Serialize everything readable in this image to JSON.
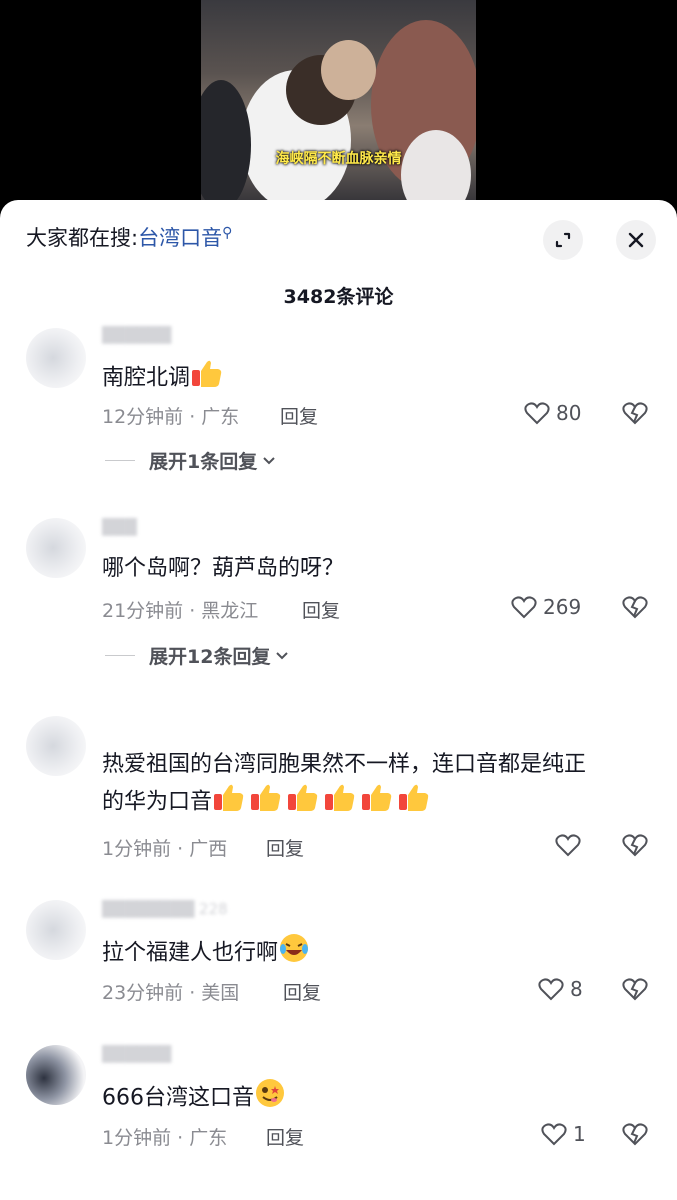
{
  "video": {
    "subtitle": "海峡隔不断血脉亲情"
  },
  "search": {
    "prefix": "大家都在搜:",
    "term": "台湾口音"
  },
  "comment_count": "3482条评论",
  "comments": [
    {
      "text": "南腔北调",
      "emoji": "thumbs-up",
      "time": "12分钟前 · 广东",
      "reply": "回复",
      "likes": "80",
      "expand": "展开1条回复"
    },
    {
      "text": "哪个岛啊？葫芦岛的呀？",
      "time": "21分钟前 · 黑龙江",
      "reply": "回复",
      "likes": "269",
      "expand": "展开12条回复"
    },
    {
      "text_line1": "热爱祖国的台湾同胞果然不一样，连口音都是纯正",
      "text_line2": "的华为口音",
      "emoji": "thumbs-up x6",
      "time": "1分钟前 · 广西",
      "reply": "回复",
      "likes": ""
    },
    {
      "text": "拉个福建人也行啊",
      "emoji": "laughing-crying",
      "time": "23分钟前 · 美国",
      "reply": "回复",
      "likes": "8"
    },
    {
      "text": "666台湾这口音",
      "emoji": "star-struck",
      "time": "1分钟前 · 广东",
      "reply": "回复",
      "likes": "1"
    }
  ],
  "colors": {
    "link": "#2d57a8",
    "subtitle": "#ffe94a",
    "meta": "#8a8b91",
    "text": "#161823"
  }
}
